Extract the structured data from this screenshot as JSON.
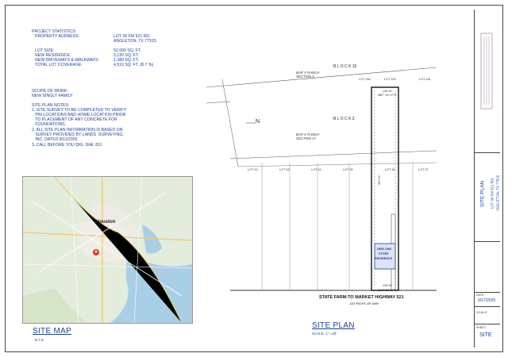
{
  "project_stats": {
    "heading": "PROJECT STATISTICS:",
    "rows": [
      {
        "label": "PROPERTY ADDRESS:",
        "value": "LOT 36 FM 521 RD."
      },
      {
        "label": "",
        "value": "ANGLETON, TX 77515"
      },
      {
        "label": "LOT SIZE:",
        "value": "52,000 SQ. FT."
      },
      {
        "label": "NEW RESIDENCE:",
        "value": "3,130 SQ. FT."
      },
      {
        "label": "NEW DRIVEWAYS & WALKWAYS:",
        "value": "1,380 SQ. FT."
      },
      {
        "label": "TOTAL LOT COVERAGE:",
        "value": "4,510 SQ. FT. (8.7 %)"
      }
    ]
  },
  "scope": {
    "heading": "SCOPE OF WORK:",
    "text": "NEW SINGLY FAMILY"
  },
  "site_notes": {
    "heading": "SITE PLAN NOTES:",
    "lines": [
      "1. SITE SURVEY TO BE COMPLETED TO VERIFY",
      "   PIN LOCATIONS AND HOME LOCATION PRIOR",
      "   TO PLACEMENT OF ANY CONCRETE FOR",
      "   FOUNDATIONS.",
      "2. ALL SITE PLAN INFORMATION IS BASED ON",
      "   SURVEY PROVIDED BY LANDS  SURVEYING,",
      "   INC. DATED 8/11/2002",
      "3. CALL BEFORE YOU DIG: DIAL 811"
    ]
  },
  "site_map": {
    "title": "SITE MAP",
    "scale": "N.T.S",
    "city": "Houston"
  },
  "site_plan": {
    "title": "SITE PLAN",
    "scale": "SCALE: 1\" =40'",
    "highway": "STATE FARM-TO MARKET HIGHWAY 521",
    "row": "120' RIGHT-OF-WAY",
    "north": "N",
    "block_top": "B  L  O  C  K       10",
    "block_bottom": "B  L  O  C  K       3",
    "ranch_top": [
      "BAR X RANCH",
      "SECTION 5"
    ],
    "ranch_bottom": [
      "BAR X RANCH",
      "SECTION 17"
    ],
    "lots": [
      "LOT 32",
      "LOT 33",
      "LOT 34",
      "LOT 35",
      "LOT 36",
      "LOT 37"
    ],
    "lots_top": [
      "LOT 160",
      "LOT 162",
      "LOT 161"
    ],
    "residence": [
      "NEW ONE",
      "STORY",
      "RESIDENCE"
    ],
    "bearing_top": "N87° 20' 47\"E",
    "bearing_bottom": "S87° 20' 17\"W",
    "dim_top": "130.00'",
    "dim_bottom": "130.00'",
    "side_dim": "397.94'"
  },
  "title_block": {
    "sheet_name": "SITE PLAN",
    "address": [
      "LOT 36 FM 521 RD.",
      "ANGLETON, TX 77515"
    ],
    "date_label": "DATE:",
    "date": "9/17/2025",
    "scale_label": "SCALE:",
    "sheet_label": "SHEET:",
    "sheet": "SITE"
  }
}
